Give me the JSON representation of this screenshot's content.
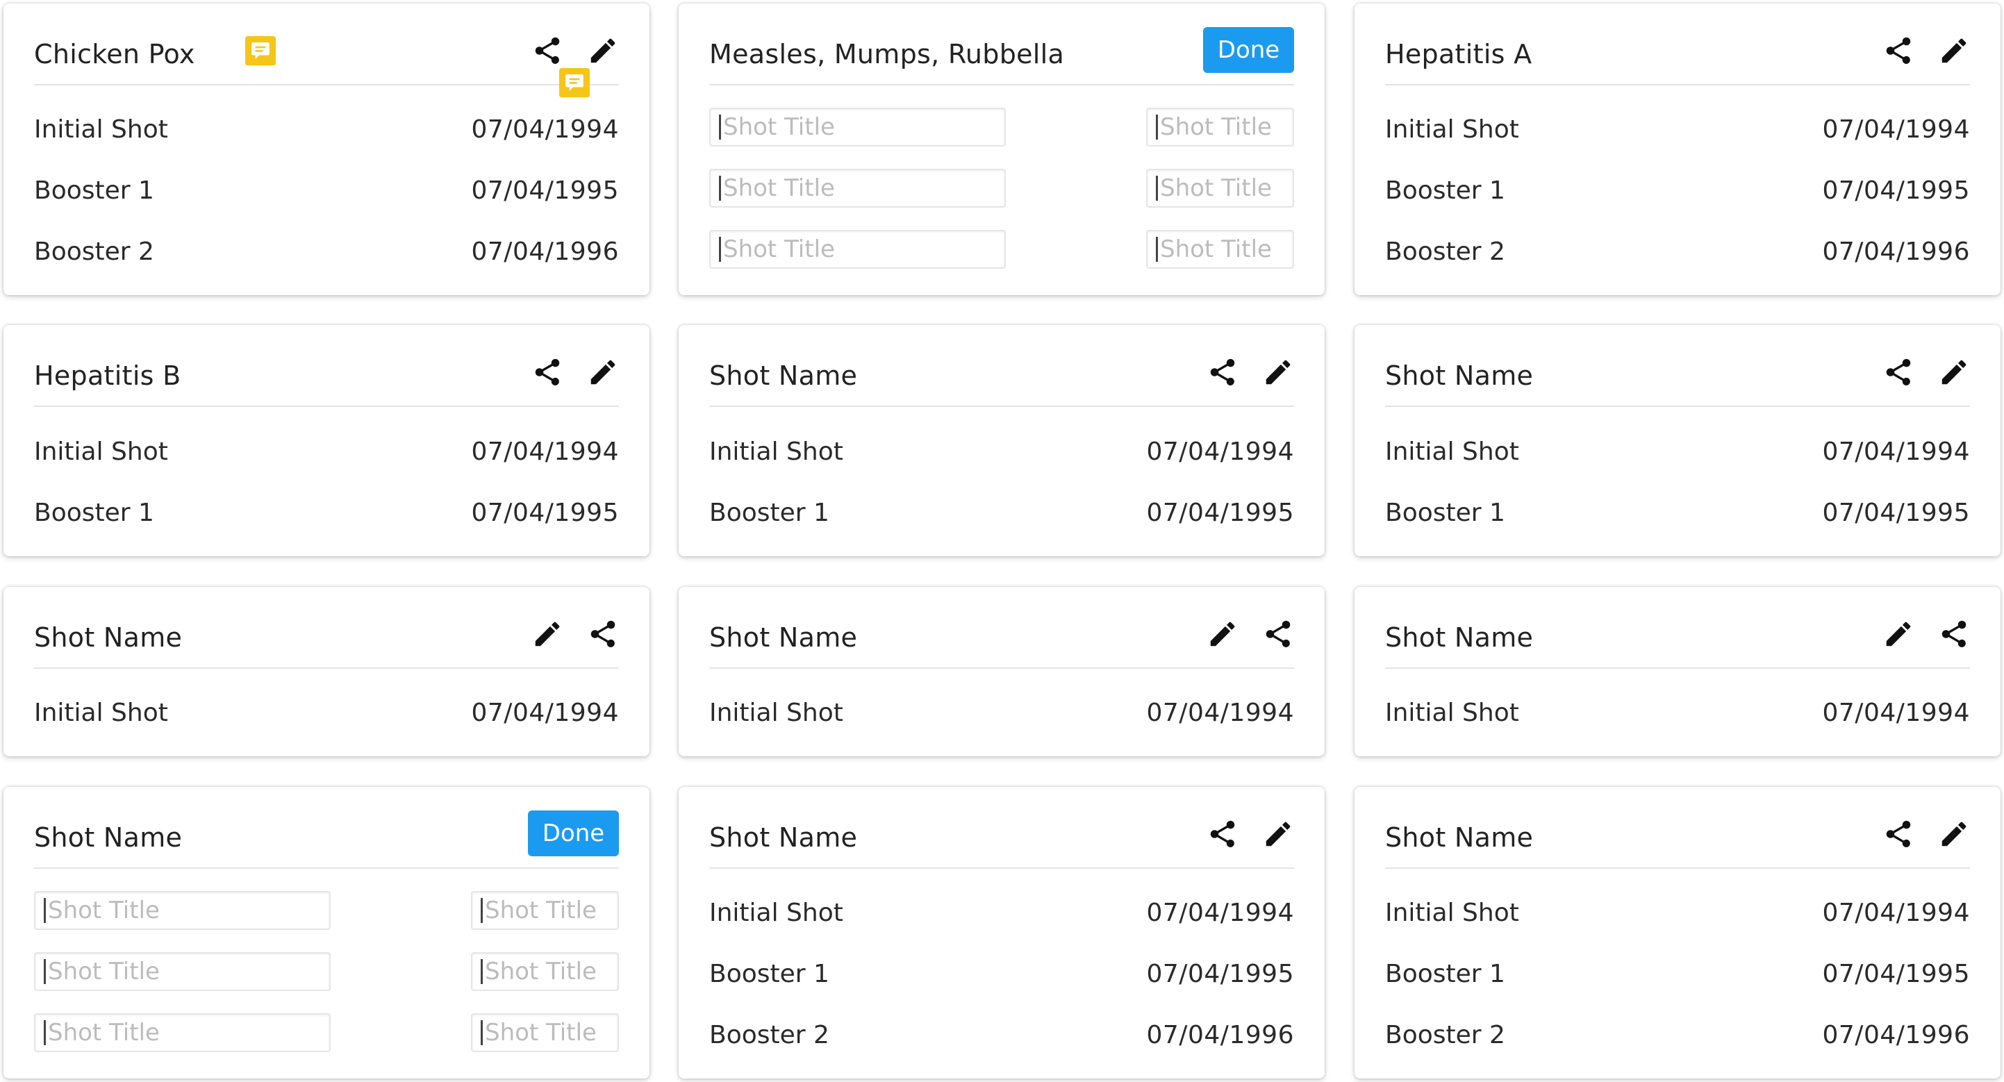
{
  "placeholder": "Shot Title",
  "done_label": "Done",
  "colors": {
    "accent": "#1b9bf0",
    "comment": "#f5c518",
    "text": "#222222"
  },
  "icons": {
    "share": "share-icon",
    "edit": "pencil-icon",
    "comment": "comment-icon"
  },
  "cards": [
    {
      "title": "Chicken Pox",
      "rows": [
        {
          "label": "Initial Shot",
          "date": "07/04/1994"
        },
        {
          "label": "Booster 1",
          "date": "07/04/1995"
        },
        {
          "label": "Booster 2",
          "date": "07/04/1996"
        }
      ]
    },
    {
      "title": "Measles, Mumps, Rubbella",
      "editing": true
    },
    {
      "title": "Hepatitis A",
      "rows": [
        {
          "label": "Initial Shot",
          "date": "07/04/1994"
        },
        {
          "label": "Booster 1",
          "date": "07/04/1995"
        },
        {
          "label": "Booster 2",
          "date": "07/04/1996"
        }
      ]
    },
    {
      "title": "Hepatitis B",
      "rows": [
        {
          "label": "Initial Shot",
          "date": "07/04/1994"
        },
        {
          "label": "Booster 1",
          "date": "07/04/1995"
        }
      ]
    },
    {
      "title": "Shot Name",
      "rows": [
        {
          "label": "Initial Shot",
          "date": "07/04/1994"
        },
        {
          "label": "Booster 1",
          "date": "07/04/1995"
        }
      ]
    },
    {
      "title": "Shot Name",
      "rows": [
        {
          "label": "Initial Shot",
          "date": "07/04/1994"
        },
        {
          "label": "Booster 1",
          "date": "07/04/1995"
        }
      ]
    },
    {
      "title": "Shot Name",
      "rows": [
        {
          "label": "Initial Shot",
          "date": "07/04/1994"
        }
      ]
    },
    {
      "title": "Shot Name",
      "rows": [
        {
          "label": "Initial Shot",
          "date": "07/04/1994"
        }
      ]
    },
    {
      "title": "Shot Name",
      "rows": [
        {
          "label": "Initial Shot",
          "date": "07/04/1994"
        }
      ]
    },
    {
      "title": "Shot Name",
      "editing": true
    },
    {
      "title": "Shot Name",
      "rows": [
        {
          "label": "Initial Shot",
          "date": "07/04/1994"
        },
        {
          "label": "Booster 1",
          "date": "07/04/1995"
        },
        {
          "label": "Booster 2",
          "date": "07/04/1996"
        }
      ]
    },
    {
      "title": "Shot Name",
      "rows": [
        {
          "label": "Initial Shot",
          "date": "07/04/1994"
        },
        {
          "label": "Booster 1",
          "date": "07/04/1995"
        },
        {
          "label": "Booster 2",
          "date": "07/04/1996"
        }
      ]
    }
  ]
}
